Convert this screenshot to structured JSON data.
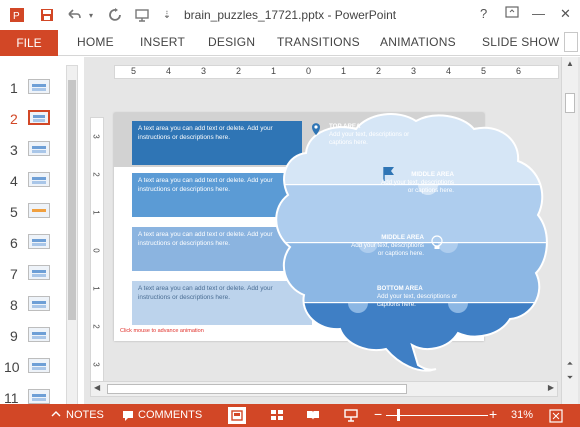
{
  "titlebar": {
    "document_title": "brain_puzzles_17721.pptx - PowerPoint",
    "save_icon": "save-icon",
    "undo_icon": "undo-icon",
    "redo_icon": "redo-icon",
    "help": "?",
    "minimize": "—",
    "close": "✕"
  },
  "ribbon": {
    "file": "FILE",
    "tabs": [
      "HOME",
      "INSERT",
      "DESIGN",
      "TRANSITIONS",
      "ANIMATIONS",
      "SLIDE SHOW"
    ]
  },
  "thumbnails": {
    "numbers": [
      "1",
      "2",
      "3",
      "4",
      "5",
      "6",
      "7",
      "8",
      "9",
      "10",
      "11"
    ],
    "active": 2
  },
  "ruler": {
    "horizontal": [
      "5",
      "4",
      "3",
      "2",
      "1",
      "0",
      "1",
      "2",
      "3",
      "4",
      "5",
      "6"
    ],
    "vertical": [
      "3",
      "2",
      "1",
      "0",
      "1",
      "2",
      "3"
    ]
  },
  "slide": {
    "textboxes": [
      "A text area you can add text or delete. Add your instructions or descriptions here.",
      "A text area you can add text or delete. Add your instructions or descriptions here.",
      "A text area you can add text or delete. Add your instructions or descriptions here.",
      "A text area you can add text or delete. Add your instructions or descriptions here."
    ],
    "regions": [
      {
        "title": "TOP AREA",
        "body": "Add your text, descriptions or captions here."
      },
      {
        "title": "MIDDLE AREA",
        "body": "Add your text, descriptions or captions here."
      },
      {
        "title": "MIDDLE AREA",
        "body": "Add your text, descriptions or captions here."
      },
      {
        "title": "BOTTOM AREA",
        "body": "Add your text, descriptions or captions here."
      }
    ],
    "note": "Click mouse to advance animation"
  },
  "status": {
    "notes": "NOTES",
    "comments": "COMMENTS",
    "zoom": "31%"
  },
  "colors": {
    "accent": "#d24726",
    "blue_dark": "#2f75b5",
    "blue_mid": "#5b9bd5",
    "blue_light": "#8bb4e0",
    "blue_pale": "#bcd3ec"
  }
}
